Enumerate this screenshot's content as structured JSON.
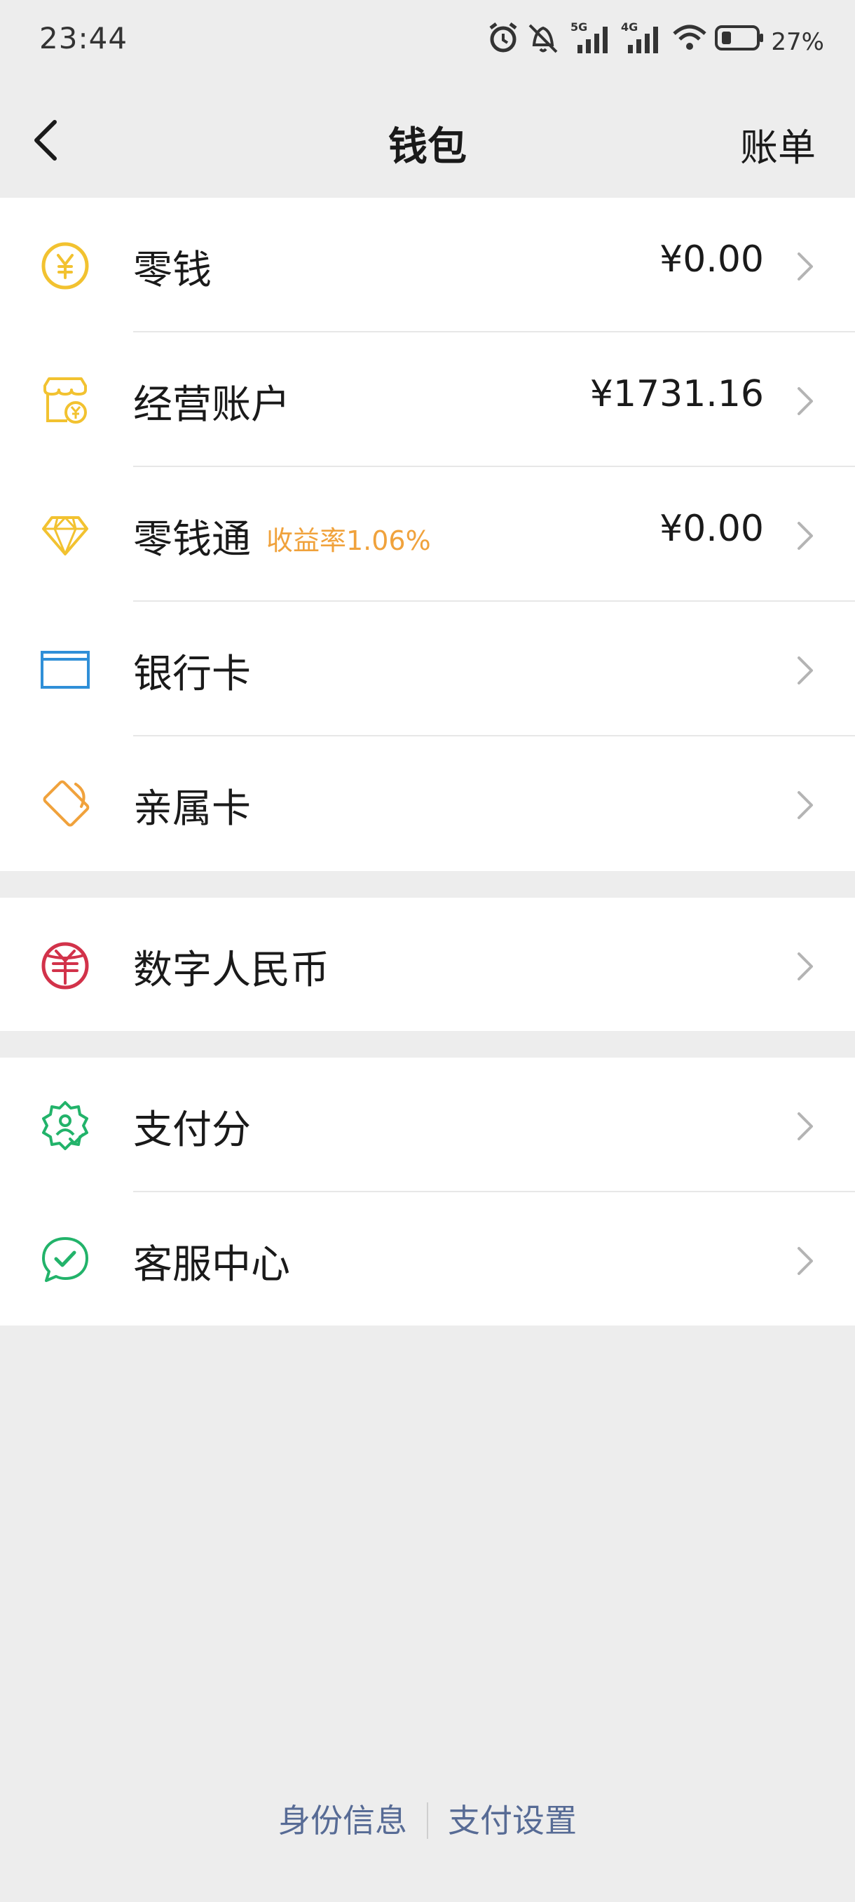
{
  "status_bar": {
    "time": "23:44",
    "network_1": "5G",
    "network_2": "4G",
    "battery": "27%"
  },
  "nav": {
    "title": "钱包",
    "right_action": "账单"
  },
  "colors": {
    "yellow": "#f2c230",
    "blue": "#2f8fd8",
    "orange": "#f0a23c",
    "red": "#d2324a",
    "green": "#22b36a",
    "link": "#576b95"
  },
  "groups": [
    {
      "items": [
        {
          "icon": "yuan-coin-icon",
          "label": "零钱",
          "value": "¥0.00"
        },
        {
          "icon": "store-icon",
          "label": "经营账户",
          "value": "¥1731.16"
        },
        {
          "icon": "diamond-icon",
          "label": "零钱通",
          "badge": "收益率1.06%",
          "value": "¥0.00"
        },
        {
          "icon": "bank-card-icon",
          "label": "银行卡"
        },
        {
          "icon": "family-card-icon",
          "label": "亲属卡"
        }
      ]
    },
    {
      "items": [
        {
          "icon": "digital-rmb-icon",
          "label": "数字人民币"
        }
      ]
    },
    {
      "items": [
        {
          "icon": "payscore-badge-icon",
          "label": "支付分"
        },
        {
          "icon": "customer-service-icon",
          "label": "客服中心"
        }
      ]
    }
  ],
  "footer": {
    "identity": "身份信息",
    "pay_settings": "支付设置"
  }
}
